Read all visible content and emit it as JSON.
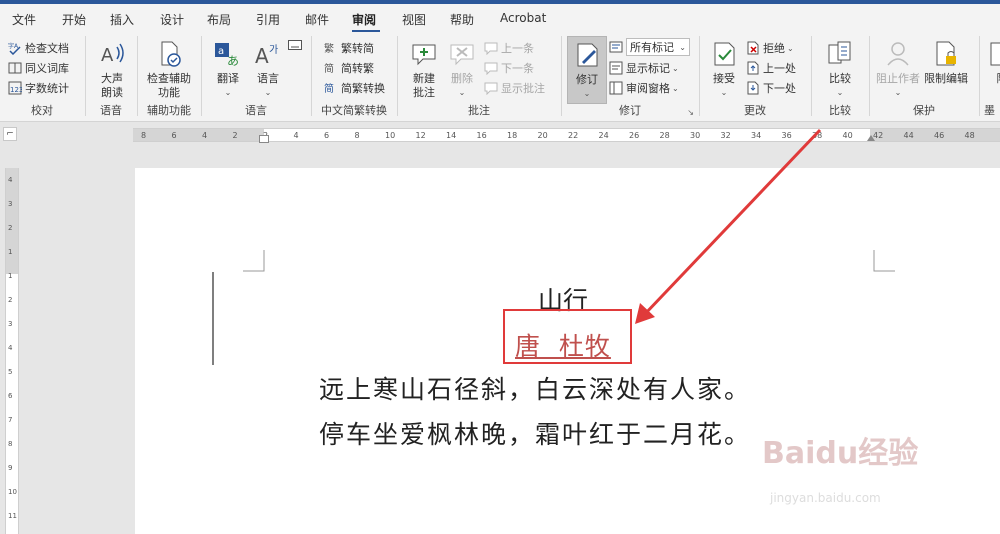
{
  "tabs": [
    "文件",
    "开始",
    "插入",
    "设计",
    "布局",
    "引用",
    "邮件",
    "审阅",
    "视图",
    "帮助",
    "Acrobat"
  ],
  "active_tab": "审阅",
  "groups": {
    "proofing": {
      "label": "校对",
      "items": [
        "检查文档",
        "同义词库",
        "字数统计"
      ]
    },
    "speech": {
      "label": "语音",
      "read_aloud": "大声朗读"
    },
    "accessibility": {
      "label": "辅助功能",
      "check": "检查辅助功能"
    },
    "language": {
      "label": "语言",
      "translate": "翻译",
      "language": "语言"
    },
    "chinese_conversion": {
      "label": "中文简繁转换",
      "items": [
        "繁转简",
        "简转繁",
        "简繁转换"
      ]
    },
    "comments": {
      "label": "批注",
      "new": "新建批注",
      "delete": "删除",
      "prev": "上一条",
      "next": "下一条",
      "show": "显示批注"
    },
    "tracking": {
      "label": "修订",
      "track": "修订",
      "markup_select": "所有标记",
      "show_markup": "显示标记",
      "pane": "审阅窗格"
    },
    "changes": {
      "label": "更改",
      "accept": "接受",
      "reject": "拒绝",
      "prev": "上一处",
      "next": "下一处"
    },
    "compare": {
      "label": "比较",
      "compare": "比较"
    },
    "protect": {
      "label": "保护",
      "block_authors": "阻止作者",
      "restrict": "限制编辑"
    },
    "more": {
      "label": "墨",
      "item": "隐"
    }
  },
  "ruler_ticks": [
    "8",
    "6",
    "4",
    "2",
    "2",
    "4",
    "6",
    "8",
    "10",
    "12",
    "14",
    "16",
    "18",
    "20",
    "22",
    "24",
    "26",
    "28",
    "30",
    "32",
    "34",
    "36",
    "38",
    "40",
    "42",
    "44",
    "46",
    "48"
  ],
  "vruler_ticks": [
    "4",
    "3",
    "2",
    "1",
    "1",
    "2",
    "3",
    "4",
    "5",
    "6",
    "7",
    "8",
    "9",
    "10",
    "11"
  ],
  "document": {
    "title": "山行",
    "author": "唐  杜牧",
    "lines": [
      "远上寒山石径斜，白云深处有人家。",
      "停车坐爱枫林晚，霜叶红于二月花。"
    ]
  },
  "watermark": {
    "main": "Baidu经验",
    "sub": "jingyan.baidu.com"
  },
  "colors": {
    "accent": "#2b579a",
    "revision": "#c0504d",
    "highlight_box": "#e03a3a"
  }
}
